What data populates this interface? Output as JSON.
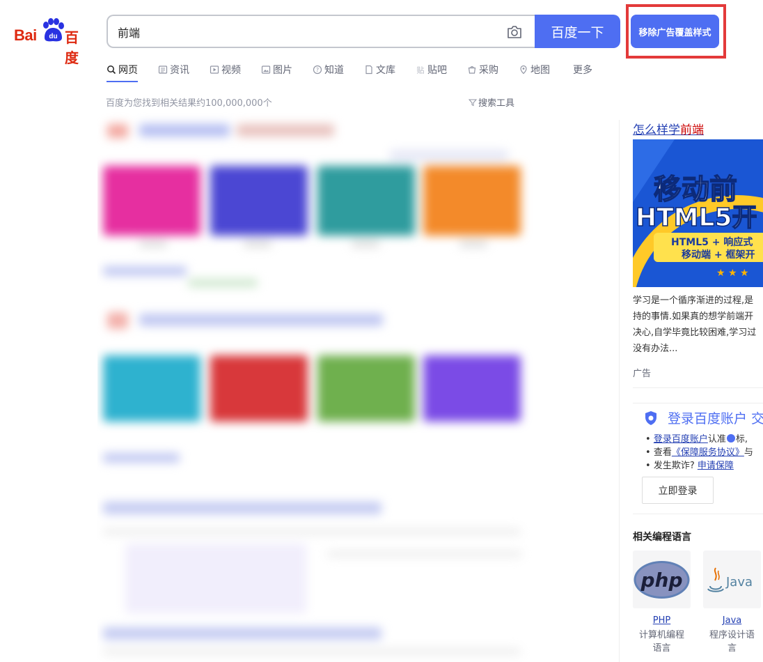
{
  "logo": {
    "text_en": "Bai",
    "text_du": "du",
    "text_cn": "百度"
  },
  "search": {
    "value": "前端",
    "button_label": "百度一下"
  },
  "remove_ad_button": "移除广告覆盖样式",
  "tabs": [
    {
      "label": "网页",
      "icon": "search-icon"
    },
    {
      "label": "资讯",
      "icon": "news-icon"
    },
    {
      "label": "视频",
      "icon": "video-icon"
    },
    {
      "label": "图片",
      "icon": "image-icon"
    },
    {
      "label": "知道",
      "icon": "question-icon"
    },
    {
      "label": "文库",
      "icon": "document-icon"
    },
    {
      "label": "贴吧",
      "icon": "tieba-icon"
    },
    {
      "label": "采购",
      "icon": "shopping-icon"
    },
    {
      "label": "地图",
      "icon": "map-icon"
    },
    {
      "label": "更多",
      "icon": ""
    }
  ],
  "result_count": "百度为您找到相关结果约100,000,000个",
  "search_tools": "搜索工具",
  "ad": {
    "title_prefix": "怎么样学",
    "title_highlight": "前端",
    "image_line1": "移动前",
    "image_line2": "HTML5开",
    "image_line3": "HTML5 + 响应式",
    "image_line4": "移动端 + 框架开",
    "desc_lines": [
      "学习是一个循序渐进的过程,是",
      "持的事情.如果真的想学前端开",
      "决心,自学毕竟比较困难,学习过",
      "没有办法..."
    ],
    "label": "广告"
  },
  "login": {
    "title": "登录百度账户 交",
    "line1_link": "登录百度账户",
    "line1_text_a": "认准",
    "line1_text_b": "标,",
    "line2_text": "查看",
    "line2_link": "《保障服务协议》",
    "line2_tail": "与",
    "line3_text": "发生欺诈?",
    "line3_link": "申请保障",
    "button": "立即登录"
  },
  "related": {
    "heading": "相关编程语言",
    "items": [
      {
        "name": "PHP",
        "desc_line1": "计算机编程",
        "desc_line2": "语言",
        "logo_text": "php"
      },
      {
        "name": "Java",
        "desc_line1": "程序设计语",
        "desc_line2": "言",
        "logo_text": "Java"
      }
    ]
  },
  "colors": {
    "brand_blue": "#4e6ef2",
    "baidu_red": "#de2910",
    "highlight_frame": "#e33a3a",
    "link": "#2440b3"
  }
}
